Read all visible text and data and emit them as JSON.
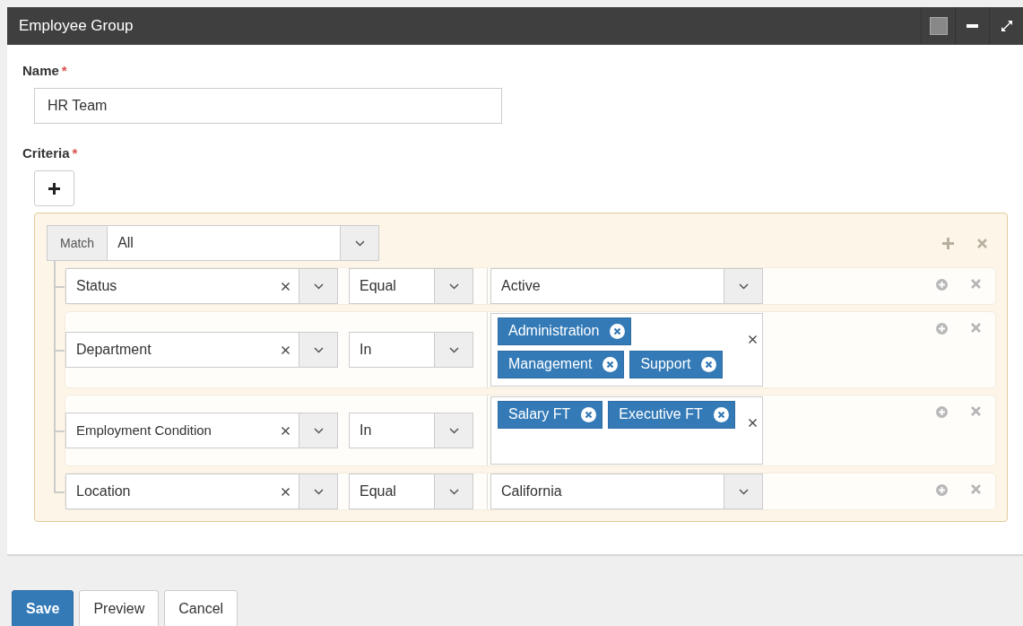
{
  "window": {
    "title": "Employee Group"
  },
  "name_field": {
    "label": "Name",
    "required_mark": "*",
    "value": "HR Team"
  },
  "criteria": {
    "label": "Criteria",
    "required_mark": "*",
    "group": {
      "match_label": "Match",
      "match_value": "All",
      "rules": [
        {
          "field": "Status",
          "operator": "Equal",
          "value": {
            "kind": "select",
            "text": "Active"
          }
        },
        {
          "field": "Department",
          "operator": "In",
          "value": {
            "kind": "tags",
            "tags": [
              "Administration",
              "Management",
              "Support"
            ]
          }
        },
        {
          "field": "Employment Condition",
          "operator": "In",
          "value": {
            "kind": "tags",
            "tags": [
              "Salary FT",
              "Executive FT"
            ]
          }
        },
        {
          "field": "Location",
          "operator": "Equal",
          "value": {
            "kind": "select",
            "text": "California"
          }
        }
      ]
    }
  },
  "buttons": [
    {
      "label": "Save",
      "kind": "primary"
    },
    {
      "label": "Preview",
      "kind": "default"
    },
    {
      "label": "Cancel",
      "kind": "default"
    }
  ]
}
